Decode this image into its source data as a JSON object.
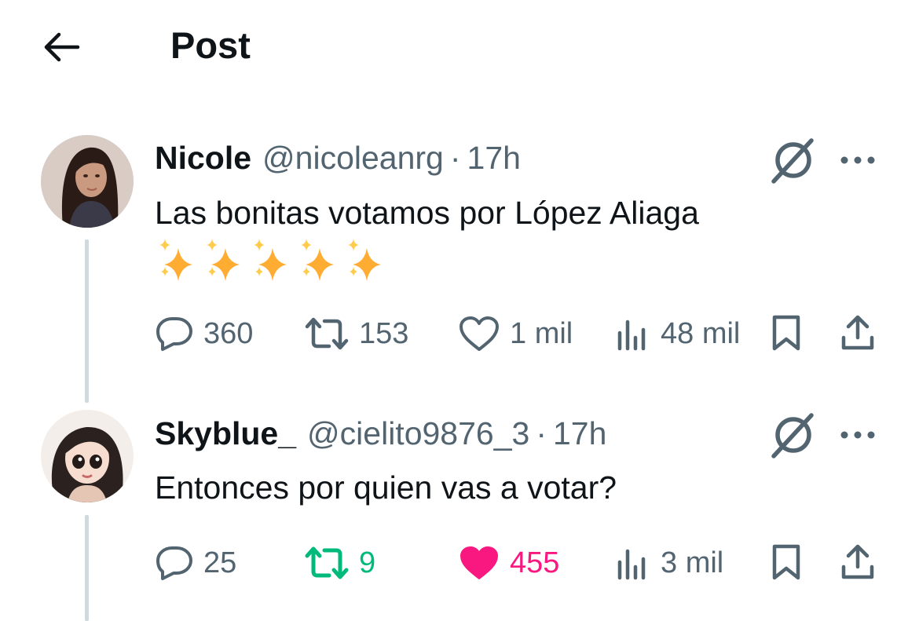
{
  "header": {
    "title": "Post"
  },
  "posts": [
    {
      "name": "Nicole",
      "handle": "@nicoleanrg",
      "separator": "·",
      "time": "17h",
      "text": "Las bonitas votamos por López Aliaga",
      "emoji_sequence": "✨✨✨✨✨",
      "stats": {
        "replies": "360",
        "reposts": "153",
        "likes": "1 mil",
        "views": "48 mil"
      },
      "liked": false,
      "reposted": false
    },
    {
      "name": "Skyblue_",
      "handle": "@cielito9876_3",
      "separator": "·",
      "time": "17h",
      "text": "Entonces por quien vas a votar?",
      "stats": {
        "replies": "25",
        "reposts": "9",
        "likes": "455",
        "views": "3 mil"
      },
      "liked": true,
      "reposted": true
    }
  ],
  "colors": {
    "text_primary": "#0f1419",
    "text_secondary": "#536471",
    "like_active": "#f91880",
    "repost_active": "#00ba7c",
    "thread_line": "#cfd9de",
    "sparkle": "#ffac33"
  },
  "icons": [
    "back-arrow-icon",
    "grok-icon",
    "more-icon",
    "reply-icon",
    "repost-icon",
    "like-icon",
    "views-icon",
    "bookmark-icon",
    "share-icon",
    "sparkles-emoji"
  ]
}
